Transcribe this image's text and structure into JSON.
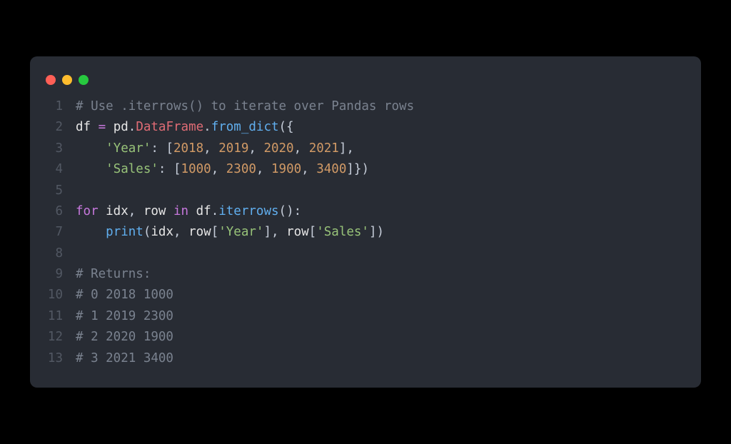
{
  "window": {
    "dots": [
      "red",
      "yellow",
      "green"
    ]
  },
  "code": {
    "lines": [
      {
        "n": "1",
        "tokens": [
          {
            "cls": "c",
            "t": "# Use .iterrows() to iterate over Pandas rows"
          }
        ]
      },
      {
        "n": "2",
        "tokens": [
          {
            "cls": "id",
            "t": "df "
          },
          {
            "cls": "op",
            "t": "="
          },
          {
            "cls": "id",
            "t": " pd"
          },
          {
            "cls": "p",
            "t": "."
          },
          {
            "cls": "attr",
            "t": "DataFrame"
          },
          {
            "cls": "p",
            "t": "."
          },
          {
            "cls": "fn",
            "t": "from_dict"
          },
          {
            "cls": "p",
            "t": "({"
          }
        ]
      },
      {
        "n": "3",
        "tokens": [
          {
            "cls": "id",
            "t": "    "
          },
          {
            "cls": "s",
            "t": "'Year'"
          },
          {
            "cls": "p",
            "t": ": ["
          },
          {
            "cls": "n",
            "t": "2018"
          },
          {
            "cls": "p",
            "t": ", "
          },
          {
            "cls": "n",
            "t": "2019"
          },
          {
            "cls": "p",
            "t": ", "
          },
          {
            "cls": "n",
            "t": "2020"
          },
          {
            "cls": "p",
            "t": ", "
          },
          {
            "cls": "n",
            "t": "2021"
          },
          {
            "cls": "p",
            "t": "],"
          }
        ]
      },
      {
        "n": "4",
        "tokens": [
          {
            "cls": "id",
            "t": "    "
          },
          {
            "cls": "s",
            "t": "'Sales'"
          },
          {
            "cls": "p",
            "t": ": ["
          },
          {
            "cls": "n",
            "t": "1000"
          },
          {
            "cls": "p",
            "t": ", "
          },
          {
            "cls": "n",
            "t": "2300"
          },
          {
            "cls": "p",
            "t": ", "
          },
          {
            "cls": "n",
            "t": "1900"
          },
          {
            "cls": "p",
            "t": ", "
          },
          {
            "cls": "n",
            "t": "3400"
          },
          {
            "cls": "p",
            "t": "]})"
          }
        ]
      },
      {
        "n": "5",
        "tokens": [
          {
            "cls": "id",
            "t": ""
          }
        ]
      },
      {
        "n": "6",
        "tokens": [
          {
            "cls": "kw",
            "t": "for"
          },
          {
            "cls": "id",
            "t": " idx"
          },
          {
            "cls": "p",
            "t": ", "
          },
          {
            "cls": "id",
            "t": "row "
          },
          {
            "cls": "kw",
            "t": "in"
          },
          {
            "cls": "id",
            "t": " df"
          },
          {
            "cls": "p",
            "t": "."
          },
          {
            "cls": "fn",
            "t": "iterrows"
          },
          {
            "cls": "p",
            "t": "():"
          }
        ]
      },
      {
        "n": "7",
        "tokens": [
          {
            "cls": "id",
            "t": "    "
          },
          {
            "cls": "fn",
            "t": "print"
          },
          {
            "cls": "p",
            "t": "("
          },
          {
            "cls": "id",
            "t": "idx"
          },
          {
            "cls": "p",
            "t": ", "
          },
          {
            "cls": "id",
            "t": "row"
          },
          {
            "cls": "p",
            "t": "["
          },
          {
            "cls": "s",
            "t": "'Year'"
          },
          {
            "cls": "p",
            "t": "], "
          },
          {
            "cls": "id",
            "t": "row"
          },
          {
            "cls": "p",
            "t": "["
          },
          {
            "cls": "s",
            "t": "'Sales'"
          },
          {
            "cls": "p",
            "t": "])"
          }
        ]
      },
      {
        "n": "8",
        "tokens": [
          {
            "cls": "id",
            "t": ""
          }
        ]
      },
      {
        "n": "9",
        "tokens": [
          {
            "cls": "c",
            "t": "# Returns:"
          }
        ]
      },
      {
        "n": "10",
        "tokens": [
          {
            "cls": "c",
            "t": "# 0 2018 1000"
          }
        ]
      },
      {
        "n": "11",
        "tokens": [
          {
            "cls": "c",
            "t": "# 1 2019 2300"
          }
        ]
      },
      {
        "n": "12",
        "tokens": [
          {
            "cls": "c",
            "t": "# 2 2020 1900"
          }
        ]
      },
      {
        "n": "13",
        "tokens": [
          {
            "cls": "c",
            "t": "# 3 2021 3400"
          }
        ]
      }
    ]
  }
}
